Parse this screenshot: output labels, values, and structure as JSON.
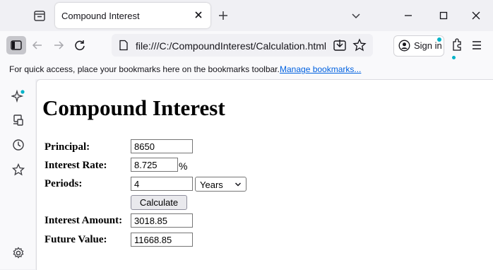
{
  "browser": {
    "tab_title": "Compound Interest",
    "url": "file:///C:/CompoundInterest/Calculation.html",
    "signin_label": "Sign in",
    "bookmarks_hint": "For quick access, place your bookmarks here on the bookmarks toolbar.",
    "bookmarks_link": "Manage bookmarks...",
    "accent_color": "#00b3c8"
  },
  "page": {
    "title": "Compound Interest",
    "principal": {
      "label": "Principal:",
      "value": "8650"
    },
    "rate": {
      "label": "Interest Rate:",
      "value": "8.725",
      "unit": "%"
    },
    "periods": {
      "label": "Periods:",
      "value": "4",
      "unit_selected": "Years"
    },
    "calculate_label": "Calculate",
    "interest_amount": {
      "label": "Interest Amount:",
      "value": "3018.85"
    },
    "future_value": {
      "label": "Future Value:",
      "value": "11668.85"
    }
  }
}
